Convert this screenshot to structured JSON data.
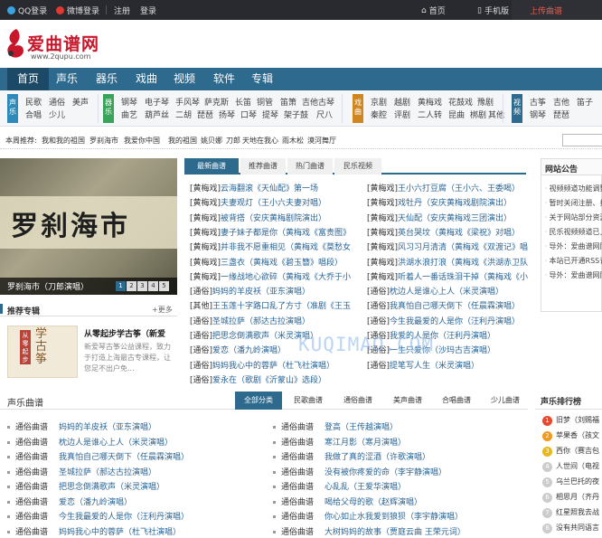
{
  "topbar": {
    "qq": "QQ登录",
    "weibo": "微博登录",
    "register": "注册",
    "login": "登录",
    "home": "首页",
    "mobile": "手机版",
    "upload": "上传曲谱"
  },
  "logo": {
    "name": "爱曲谱网",
    "url": "www.2qupu.com"
  },
  "nav": [
    "首页",
    "声乐",
    "器乐",
    "戏曲",
    "视频",
    "软件",
    "专辑"
  ],
  "subnav": {
    "g1": {
      "tag": "声乐",
      "links": [
        "民歌",
        "通俗",
        "美声",
        "合唱",
        "少儿"
      ]
    },
    "g2": {
      "tag": "器乐",
      "links": [
        "钢琴",
        "电子琴",
        "手风琴",
        "萨克斯",
        "长笛",
        "铜管",
        "笛箫",
        "吉他古琴",
        "古筝",
        "曲艺",
        "葫芦丝",
        "二胡",
        "琵琶",
        "扬琴",
        "口琴",
        "提琴",
        "架子鼓",
        "尺八"
      ]
    },
    "g3": {
      "tag": "戏曲",
      "links": [
        "京剧",
        "越剧",
        "黄梅戏",
        "花鼓戏",
        "豫剧",
        "秦腔",
        "评剧",
        "二人转",
        "昆曲",
        "梆剧",
        "其他"
      ]
    },
    "g4": {
      "tag": "视频",
      "links": [
        "古筝",
        "吉他",
        "笛子",
        "钢琴",
        "琵琶"
      ]
    }
  },
  "tagbar": {
    "label": "本周推荐:",
    "links": [
      "我和我的祖国",
      "罗刹海市",
      "我爱你中国",
      "我的祖国",
      "姚贝娜",
      "刀郎",
      "天地在我心",
      "雨木松",
      "漠河舞厅"
    ]
  },
  "banner": {
    "title": "罗刹海市",
    "caption": "罗刹海市（刀郎演唱）",
    "dots": [
      "1",
      "2",
      "3",
      "4",
      "5"
    ]
  },
  "rec": {
    "title": "推荐专辑",
    "more": "+更多",
    "thumb_tag": "从零起步",
    "thumb_title": "学古筝",
    "item_title": "从零起步学古筝（新爱",
    "item_desc": "新爱琴古筝公益课程，致力于打造上海最古专课程，让您足不出户免..."
  },
  "mid": {
    "tabs": [
      "最新曲谱",
      "推荐曲谱",
      "热门曲谱",
      "民乐视频"
    ],
    "left": [
      {
        "cat": "[黄梅戏]",
        "name": "云海翻滚《天仙配》第一场"
      },
      {
        "cat": "[黄梅戏]",
        "name": "夫妻观灯（王小六夫妻对唱）"
      },
      {
        "cat": "[黄梅戏]",
        "name": "被背搭（安庆黄梅剧院演出）"
      },
      {
        "cat": "[黄梅戏]",
        "name": "妻子妹子都是你（黄梅戏《富贵图》"
      },
      {
        "cat": "[黄梅戏]",
        "name": "并非我不愿重相见（黄梅戏《莫愁女》"
      },
      {
        "cat": "[黄梅戏]",
        "name": "三盏衣（黄梅戏《碧玉簪》唱段）"
      },
      {
        "cat": "[黄梅戏]",
        "name": "一缘战地心欲碎（黄梅戏《大乔于小"
      },
      {
        "cat": "[通俗]",
        "name": "妈妈的羊皮袄（亚东演唱）"
      },
      {
        "cat": "[其他]",
        "name": "王玉莲十字路口乱了方寸（准剧《王玉"
      },
      {
        "cat": "[通俗]",
        "name": "圣城拉萨（郝达古拉演唱）"
      },
      {
        "cat": "[通俗]",
        "name": "把思念倒满歌声（米灵演唱）"
      },
      {
        "cat": "[通俗]",
        "name": "爱恋（潘九岭演唱）"
      },
      {
        "cat": "[通俗]",
        "name": "妈妈我心中的蓉萨（杜飞社演唱）"
      },
      {
        "cat": "[通俗]",
        "name": "爱永在（歌剧《沂蒙山》选段）"
      }
    ],
    "right": [
      {
        "cat": "[黄梅戏]",
        "name": "王小六打豆腐（王小六、王委喝）"
      },
      {
        "cat": "[黄梅戏]",
        "name": "戏牡丹（安庆黄梅戏剧院演出）"
      },
      {
        "cat": "[黄梅戏]",
        "name": "天仙配（安庆黄梅戏三团演出）"
      },
      {
        "cat": "[黄梅戏]",
        "name": "英台哭坟（黄梅戏《梁祝》对唱）"
      },
      {
        "cat": "[黄梅戏]",
        "name": "风习习月清清（黄梅戏《双渡记》唱"
      },
      {
        "cat": "[黄梅戏]",
        "name": "洪湖水浪打浪（黄梅戏《洪湖赤卫队"
      },
      {
        "cat": "[黄梅戏]",
        "name": "听着人一番话珠泪干掉（黄梅戏《小"
      },
      {
        "cat": "[通俗]",
        "name": "枕边人是谁心上人（米灵演唱）"
      },
      {
        "cat": "[通俗]",
        "name": "我真怕自己哪天倒下（任晨霖演唱）"
      },
      {
        "cat": "[通俗]",
        "name": "今生我最爱的人是你（汪利丹演唱）"
      },
      {
        "cat": "[通俗]",
        "name": "我爱的人是你（汪利丹演唱）"
      },
      {
        "cat": "[通俗]",
        "name": "一生只爱你（沙玛古吉演唱）"
      },
      {
        "cat": "[通俗]",
        "name": "提笔写人生（米灵演唱）"
      }
    ]
  },
  "watermark": "KUQIMAO.COM",
  "notice": {
    "title": "网站公告",
    "items": [
      "视频频道功能调整",
      "暂时关闭注册、投稿",
      "关于网站部分资源说明",
      "民乐视频频道已上线",
      "导外：爱曲谱网同步上线",
      "本站已开通RSS订阅",
      "导外：爱曲谱网同步上线"
    ]
  },
  "sec": {
    "title": "声乐曲谱",
    "tabs": [
      "全部分类",
      "民歌曲谱",
      "通俗曲谱",
      "美声曲谱",
      "合唱曲谱",
      "少儿曲谱"
    ],
    "left": [
      {
        "cat": "通俗曲谱",
        "name": "妈妈的羊皮袄（亚东演唱）"
      },
      {
        "cat": "通俗曲谱",
        "name": "枕边人是谁心上人（米灵演唱）"
      },
      {
        "cat": "通俗曲谱",
        "name": "我真怕自己哪天倒下（任晨霖演唱）"
      },
      {
        "cat": "通俗曲谱",
        "name": "圣城拉萨（郝达古拉演唱）"
      },
      {
        "cat": "通俗曲谱",
        "name": "把思念倒满歌声（米灵演唱）"
      },
      {
        "cat": "通俗曲谱",
        "name": "爱恋（潘九岭演唱）"
      },
      {
        "cat": "通俗曲谱",
        "name": "今生我最爱的人是你（汪利丹演唱）"
      },
      {
        "cat": "通俗曲谱",
        "name": "妈妈我心中的蓉萨（杜飞社演唱）"
      }
    ],
    "right": [
      {
        "cat": "通俗曲谱",
        "name": "登高（王传越演唱）"
      },
      {
        "cat": "通俗曲谱",
        "name": "寒江月影（寒月演唱）"
      },
      {
        "cat": "通俗曲谱",
        "name": "我做了真的涩酒（许歌演唱）"
      },
      {
        "cat": "通俗曲谱",
        "name": "没有被你疼爱的命（李宇静演唱）"
      },
      {
        "cat": "通俗曲谱",
        "name": "心乱乱（王爱华演唱）"
      },
      {
        "cat": "通俗曲谱",
        "name": "喝给父母的歌（赵辉演唱）"
      },
      {
        "cat": "通俗曲谱",
        "name": "你心如止水我爱到狼狈（李宇静演唱）"
      },
      {
        "cat": "通俗曲谱",
        "name": "大树妈妈的故事（贾庭云曲 王荣元词）"
      }
    ]
  },
  "rank": {
    "title": "声乐排行榜",
    "items": [
      "旧梦（刘赐福",
      "苹果香（孩文",
      "西你（赛吉包",
      "人世间（电视",
      "乌兰巴托的夜",
      "相思月（齐丹",
      "红星照我去战",
      "没有共同语言"
    ]
  },
  "colors": {
    "nav": "#2e6a8e",
    "topbar": "#282a30",
    "link": "#2a6496",
    "brand": "#c8162a"
  }
}
